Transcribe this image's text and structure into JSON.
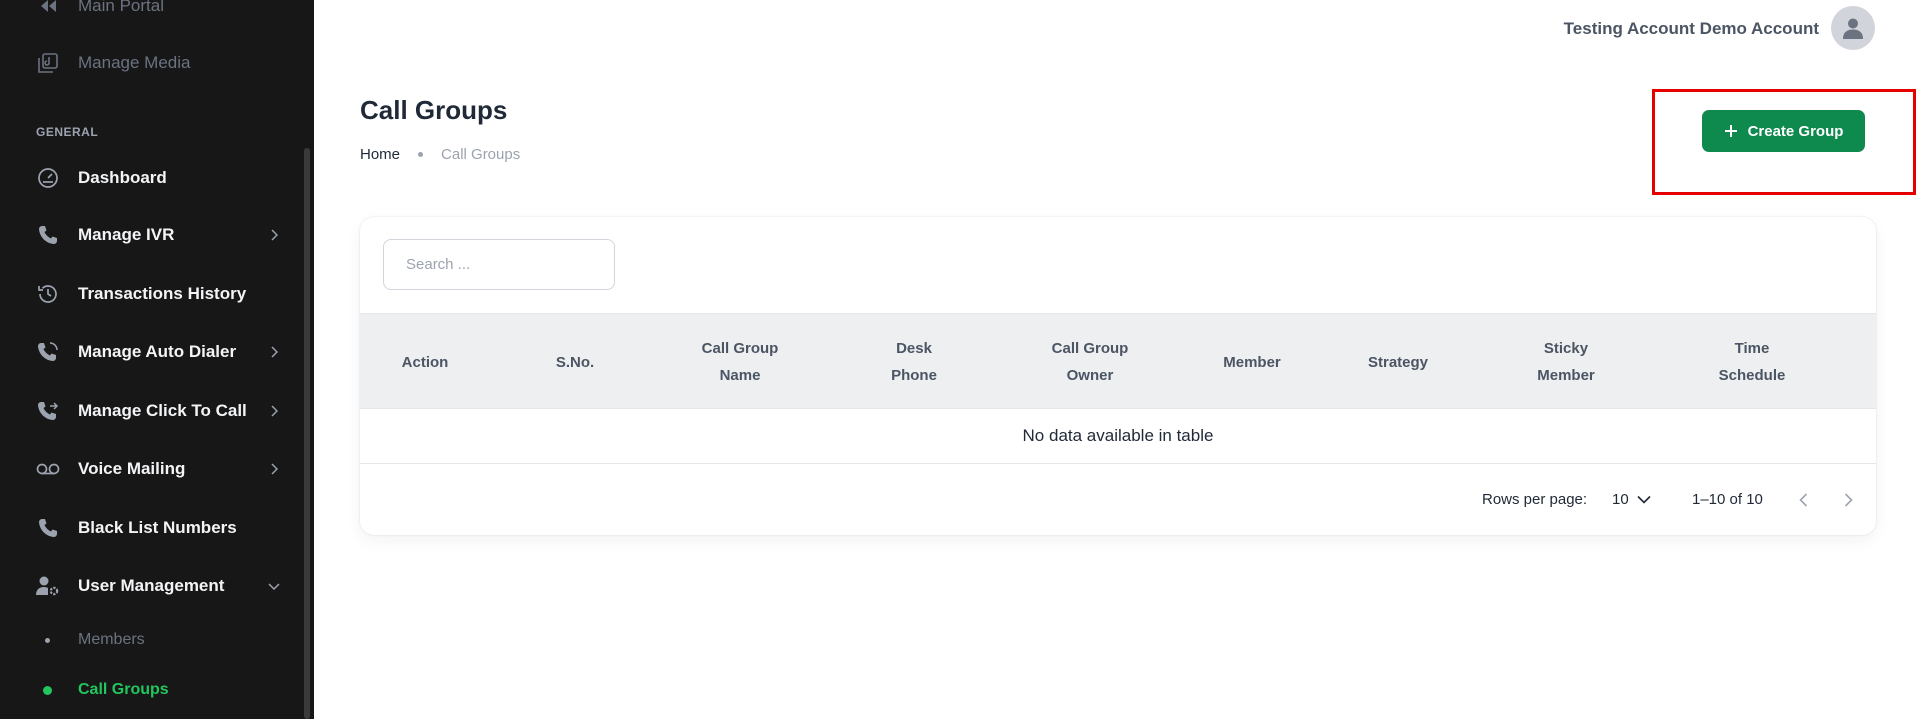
{
  "sidebar": {
    "top_items": [
      {
        "label": "Main Portal",
        "icon": "rewind-icon"
      },
      {
        "label": "Manage Media",
        "icon": "media-icon"
      }
    ],
    "section_label": "GENERAL",
    "items": [
      {
        "label": "Dashboard",
        "icon": "gauge-icon"
      },
      {
        "label": "Manage IVR",
        "icon": "phone-icon"
      },
      {
        "label": "Transactions History",
        "icon": "history-icon"
      },
      {
        "label": "Manage Auto Dialer",
        "icon": "phone-auto-icon"
      },
      {
        "label": "Manage Click To Call",
        "icon": "phone-forward-icon"
      },
      {
        "label": "Voice Mailing",
        "icon": "voicemail-icon"
      },
      {
        "label": "Black List Numbers",
        "icon": "phone-icon"
      },
      {
        "label": "User Management",
        "icon": "user-cog-icon"
      }
    ],
    "sub_items": [
      {
        "label": "Members"
      },
      {
        "label": "Call Groups"
      }
    ]
  },
  "header": {
    "account_name": "Testing Account Demo Account",
    "avatar_icon": "user-icon"
  },
  "page": {
    "title": "Call Groups",
    "breadcrumb": {
      "home": "Home",
      "current": "Call Groups"
    },
    "create_button": "Create Group"
  },
  "table": {
    "search_placeholder": "Search ...",
    "columns": [
      {
        "line1": "Action",
        "line2": ""
      },
      {
        "line1": "S.No.",
        "line2": ""
      },
      {
        "line1": "Call Group",
        "line2": "Name"
      },
      {
        "line1": "Desk",
        "line2": "Phone"
      },
      {
        "line1": "Call Group",
        "line2": "Owner"
      },
      {
        "line1": "Member",
        "line2": ""
      },
      {
        "line1": "Strategy",
        "line2": ""
      },
      {
        "line1": "Sticky",
        "line2": "Member"
      },
      {
        "line1": "Time",
        "line2": "Schedule"
      }
    ],
    "empty_message": "No data available in table",
    "rows_per_page_label": "Rows per page:",
    "rows_per_page_value": "10",
    "range_label": "1–10 of 10"
  },
  "colors": {
    "sidebar_bg": "#171717",
    "accent_green": "#0e8a4f",
    "active_green": "#22c55e",
    "highlight_red": "#e60000"
  }
}
